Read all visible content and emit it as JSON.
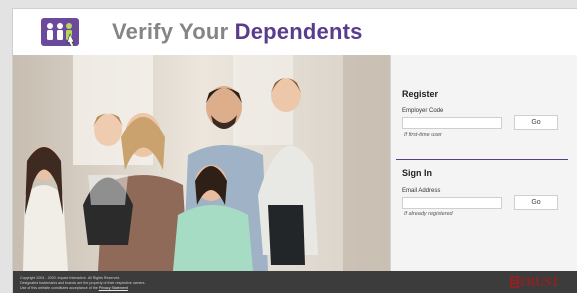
{
  "header": {
    "title_part1": "Verify Your",
    "title_part2": "Dependents",
    "logo_icon": "family-users-icon",
    "brand_color": "#5a3c8c"
  },
  "photo": {
    "icon": "family-photo"
  },
  "register": {
    "heading": "Register",
    "employer_code_label": "Employer Code",
    "employer_code_value": "",
    "go_label": "Go",
    "hint": "If first-time user"
  },
  "signin": {
    "heading": "Sign In",
    "email_label": "Email Address",
    "email_value": "",
    "go_label": "Go",
    "hint": "If already registered"
  },
  "footer": {
    "copyright": "Copyright 2004 - 2020. Impact Interactive. All Rights Reserved.",
    "trademarks": "Designated trademarks and brands are the property of their respective owners.",
    "usage_prefix": "Use of this website constitutes acceptance of the",
    "privacy_link": "Privacy Statement",
    "trust_badge": "TRUST",
    "trust_badge_icon": "truste-seal-icon",
    "trust_color": "#8e2222"
  }
}
